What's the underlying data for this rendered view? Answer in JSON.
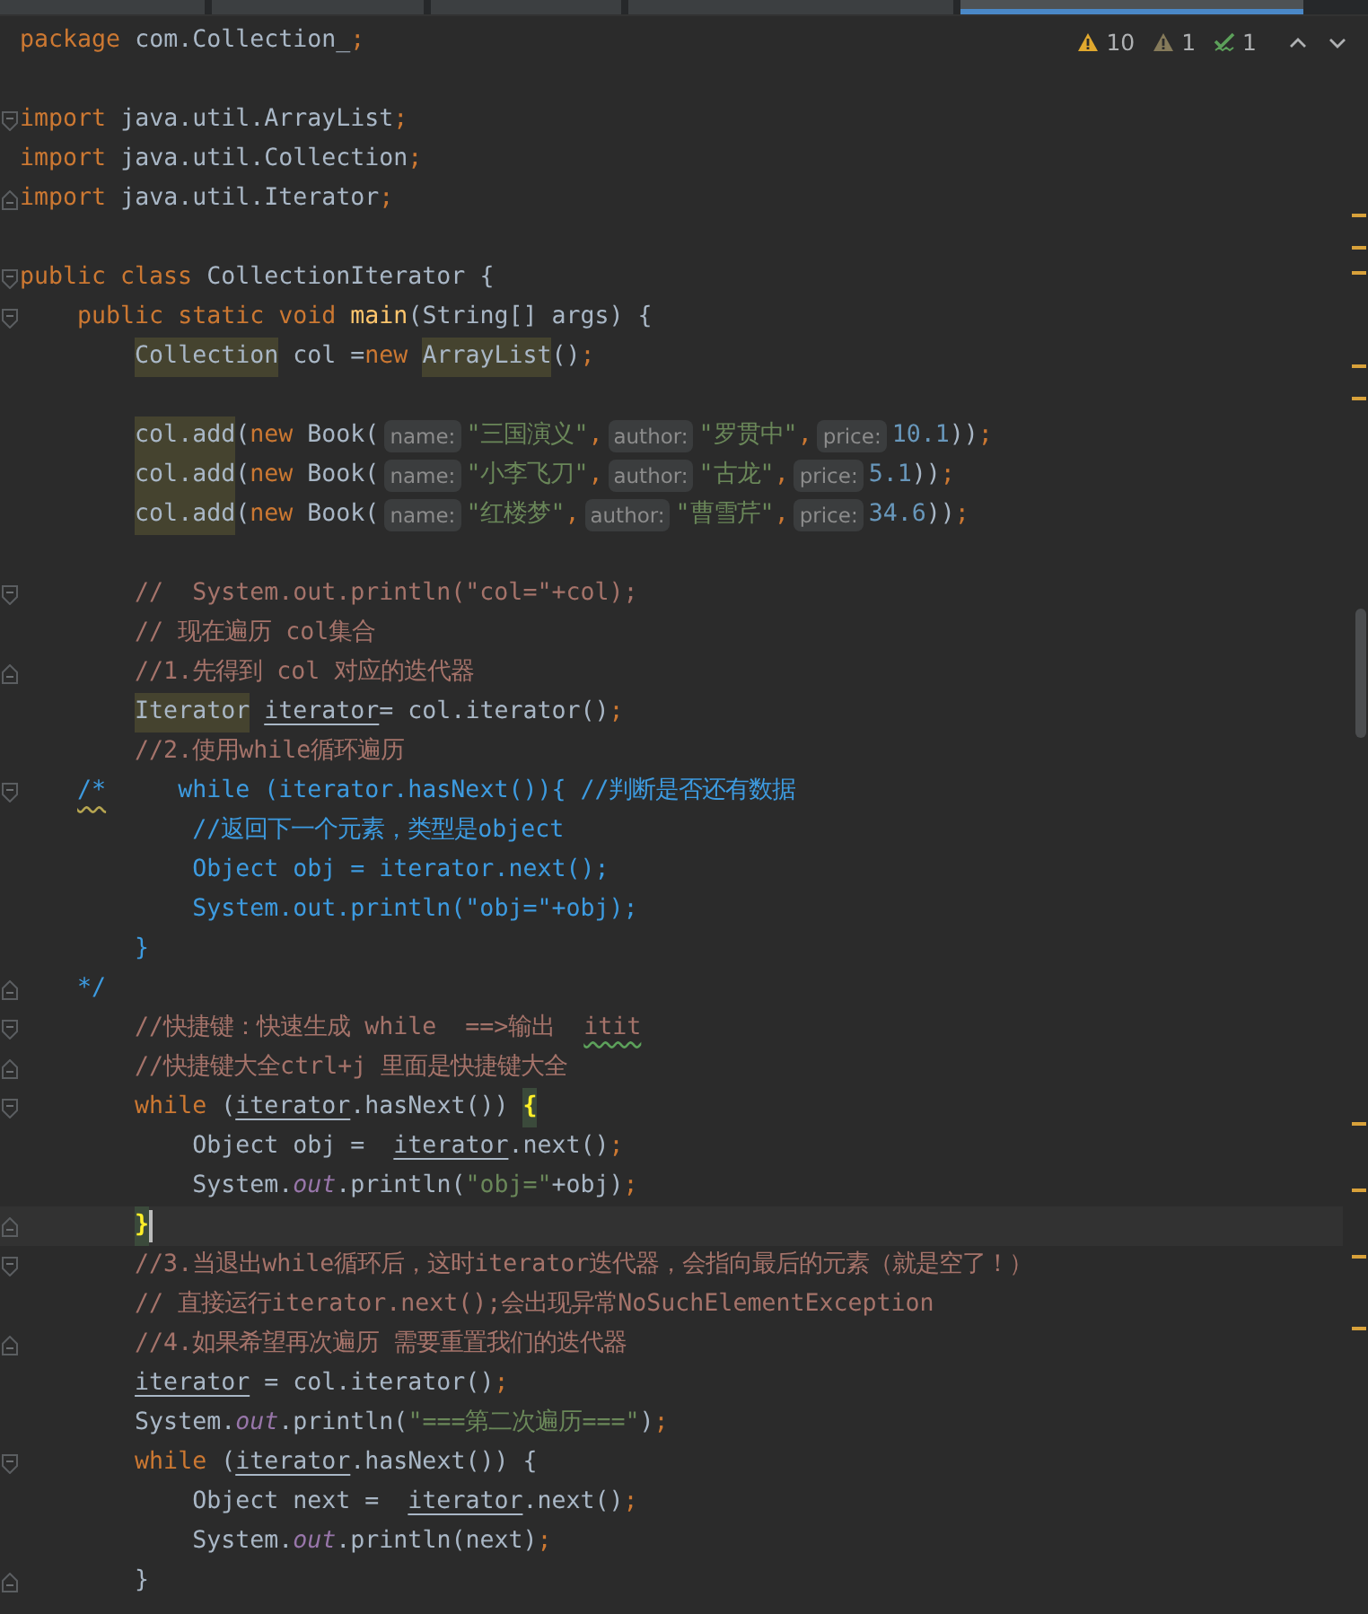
{
  "tabs": [
    {
      "selected": false
    },
    {
      "selected": false
    },
    {
      "selected": false
    },
    {
      "selected": false
    },
    {
      "selected": true
    }
  ],
  "inspections": [
    {
      "kind": "warning",
      "count": "10"
    },
    {
      "kind": "weak",
      "count": "1"
    },
    {
      "kind": "typo",
      "count": "1"
    }
  ],
  "lines": [
    {
      "current": false,
      "fold_open": false,
      "fold_close": false,
      "tokens": [
        {
          "kind": "keyword",
          "text": "package"
        },
        {
          "kind": "plain",
          "text": " com.Collection_"
        },
        {
          "kind": "punct",
          "text": ";"
        }
      ]
    },
    {
      "current": false,
      "fold_open": false,
      "fold_close": false
    },
    {
      "current": false,
      "fold_open": true,
      "fold_close": false,
      "tokens": [
        {
          "kind": "keyword",
          "text": "import"
        },
        {
          "kind": "plain",
          "text": " java.util.ArrayList"
        },
        {
          "kind": "punct",
          "text": ";"
        }
      ]
    },
    {
      "current": false,
      "fold_open": false,
      "fold_close": false,
      "tokens": [
        {
          "kind": "keyword",
          "text": "import"
        },
        {
          "kind": "plain",
          "text": " java.util.Collection"
        },
        {
          "kind": "punct",
          "text": ";"
        }
      ]
    },
    {
      "current": false,
      "fold_open": false,
      "fold_close": true,
      "tokens": [
        {
          "kind": "keyword",
          "text": "import"
        },
        {
          "kind": "plain",
          "text": " java.util.Iterator"
        },
        {
          "kind": "punct",
          "text": ";"
        }
      ]
    },
    {
      "current": false,
      "fold_open": false,
      "fold_close": false
    },
    {
      "current": false,
      "fold_open": true,
      "fold_close": false,
      "tokens": [
        {
          "kind": "keyword",
          "text": "public class"
        },
        {
          "kind": "plain",
          "text": " CollectionIterator {"
        }
      ]
    },
    {
      "current": false,
      "fold_open": true,
      "fold_close": false,
      "tokens": [
        {
          "kind": "keyword",
          "text": "    public static void"
        },
        {
          "kind": "method",
          "text": " main"
        },
        {
          "kind": "plain",
          "text": "(String[] args) {"
        }
      ]
    },
    {
      "current": false,
      "fold_open": false,
      "fold_close": false,
      "tokens": [
        {
          "kind": "highlight",
          "text": "        Collection"
        },
        {
          "kind": "plain",
          "text": " col ="
        },
        {
          "kind": "keyword",
          "text": "new"
        },
        {
          "kind": "highlight",
          "text": " ArrayList"
        },
        {
          "kind": "plain",
          "text": "()"
        },
        {
          "kind": "punct",
          "text": ";"
        }
      ]
    },
    {
      "current": false,
      "fold_open": false,
      "fold_close": false
    },
    {
      "current": false,
      "fold_open": false,
      "fold_close": false,
      "tokens": [
        {
          "kind": "highlight",
          "text": "        col.add"
        },
        {
          "kind": "plain",
          "text": "("
        },
        {
          "kind": "keyword",
          "text": "new"
        },
        {
          "kind": "plain",
          "text": " Book("
        },
        {
          "kind": "hint",
          "text": "name:"
        },
        {
          "kind": "string",
          "text": "\"三国演义\""
        },
        {
          "kind": "punct",
          "text": ","
        },
        {
          "kind": "hint",
          "text": "author:"
        },
        {
          "kind": "string",
          "text": "\"罗贯中\""
        },
        {
          "kind": "punct",
          "text": ","
        },
        {
          "kind": "hint",
          "text": "price:"
        },
        {
          "kind": "number",
          "text": "10.1"
        },
        {
          "kind": "plain",
          "text": "))"
        },
        {
          "kind": "punct",
          "text": ";"
        }
      ]
    },
    {
      "current": false,
      "fold_open": false,
      "fold_close": false,
      "tokens": [
        {
          "kind": "highlight",
          "text": "        col.add"
        },
        {
          "kind": "plain",
          "text": "("
        },
        {
          "kind": "keyword",
          "text": "new"
        },
        {
          "kind": "plain",
          "text": " Book("
        },
        {
          "kind": "hint",
          "text": "name:"
        },
        {
          "kind": "string",
          "text": "\"小李飞刀\""
        },
        {
          "kind": "punct",
          "text": ","
        },
        {
          "kind": "hint",
          "text": "author:"
        },
        {
          "kind": "string",
          "text": "\"古龙\""
        },
        {
          "kind": "punct",
          "text": ","
        },
        {
          "kind": "hint",
          "text": "price:"
        },
        {
          "kind": "number",
          "text": "5.1"
        },
        {
          "kind": "plain",
          "text": "))"
        },
        {
          "kind": "punct",
          "text": ";"
        }
      ]
    },
    {
      "current": false,
      "fold_open": false,
      "fold_close": false,
      "tokens": [
        {
          "kind": "highlight",
          "text": "        col.add"
        },
        {
          "kind": "plain",
          "text": "("
        },
        {
          "kind": "keyword",
          "text": "new"
        },
        {
          "kind": "plain",
          "text": " Book("
        },
        {
          "kind": "hint",
          "text": "name:"
        },
        {
          "kind": "string",
          "text": "\"红楼梦\""
        },
        {
          "kind": "punct",
          "text": ","
        },
        {
          "kind": "hint",
          "text": "author:"
        },
        {
          "kind": "string",
          "text": "\"曹雪芹\""
        },
        {
          "kind": "punct",
          "text": ","
        },
        {
          "kind": "hint",
          "text": "price:"
        },
        {
          "kind": "number",
          "text": "34.6"
        },
        {
          "kind": "plain",
          "text": "))"
        },
        {
          "kind": "punct",
          "text": ";"
        }
      ]
    },
    {
      "current": false,
      "fold_open": false,
      "fold_close": false
    },
    {
      "current": false,
      "fold_open": true,
      "fold_close": false,
      "tokens": [
        {
          "kind": "comment",
          "text": "        //  System.out.println(\"col=\"+col);"
        }
      ]
    },
    {
      "current": false,
      "fold_open": false,
      "fold_close": false,
      "tokens": [
        {
          "kind": "comment",
          "text": "        // 现在遍历 col集合"
        }
      ]
    },
    {
      "current": false,
      "fold_open": false,
      "fold_close": true,
      "tokens": [
        {
          "kind": "comment",
          "text": "        //1.先得到 col 对应的迭代器"
        }
      ]
    },
    {
      "current": false,
      "fold_open": false,
      "fold_close": false,
      "tokens": [
        {
          "kind": "highlight",
          "text": "        Iterator"
        },
        {
          "kind": "underline",
          "text": " iterator"
        },
        {
          "kind": "plain",
          "text": "= col.iterator()"
        },
        {
          "kind": "punct",
          "text": ";"
        }
      ]
    },
    {
      "current": false,
      "fold_open": false,
      "fold_close": false,
      "tokens": [
        {
          "kind": "comment",
          "text": "        //2.使用while循环遍历"
        }
      ]
    },
    {
      "current": false,
      "fold_open": true,
      "fold_close": false,
      "tokens": [
        {
          "kind": "doc-typo",
          "text": "    /*"
        },
        {
          "kind": "doc",
          "text": "     while (iterator.hasNext()){ //判断是否还有数据"
        }
      ]
    },
    {
      "current": false,
      "fold_open": false,
      "fold_close": false,
      "tokens": [
        {
          "kind": "doc",
          "text": "            //返回下一个元素，类型是object"
        }
      ]
    },
    {
      "current": false,
      "fold_open": false,
      "fold_close": false,
      "tokens": [
        {
          "kind": "doc",
          "text": "            Object obj = iterator.next();"
        }
      ]
    },
    {
      "current": false,
      "fold_open": false,
      "fold_close": false,
      "tokens": [
        {
          "kind": "doc",
          "text": "            System.out.println(\"obj=\"+obj);"
        }
      ]
    },
    {
      "current": false,
      "fold_open": false,
      "fold_close": false,
      "tokens": [
        {
          "kind": "doc",
          "text": "        }"
        }
      ]
    },
    {
      "current": false,
      "fold_open": false,
      "fold_close": true,
      "tokens": [
        {
          "kind": "doc",
          "text": "    */"
        }
      ]
    },
    {
      "current": false,
      "fold_open": true,
      "fold_close": false,
      "tokens": [
        {
          "kind": "comment",
          "text": "        //快捷键：快速生成 while  ==>输出"
        },
        {
          "kind": "typo",
          "text": "  itit"
        }
      ]
    },
    {
      "current": false,
      "fold_open": false,
      "fold_close": true,
      "tokens": [
        {
          "kind": "comment",
          "text": "        //快捷键大全ctrl+j 里面是快捷键大全"
        }
      ]
    },
    {
      "current": false,
      "fold_open": true,
      "fold_close": false,
      "tokens": [
        {
          "kind": "keyword",
          "text": "        while"
        },
        {
          "kind": "plain",
          "text": " ("
        },
        {
          "kind": "underline",
          "text": "iterator"
        },
        {
          "kind": "plain",
          "text": ".hasNext())"
        },
        {
          "kind": "match",
          "text": " {"
        }
      ]
    },
    {
      "current": false,
      "fold_open": false,
      "fold_close": false,
      "tokens": [
        {
          "kind": "plain",
          "text": "            Object obj ="
        },
        {
          "kind": "underline",
          "text": "  iterator"
        },
        {
          "kind": "plain",
          "text": ".next()"
        },
        {
          "kind": "punct",
          "text": ";"
        }
      ]
    },
    {
      "current": false,
      "fold_open": false,
      "fold_close": false,
      "tokens": [
        {
          "kind": "plain",
          "text": "            System."
        },
        {
          "kind": "field",
          "text": "out"
        },
        {
          "kind": "plain",
          "text": ".println("
        },
        {
          "kind": "string",
          "text": "\"obj=\""
        },
        {
          "kind": "plain",
          "text": "+obj)"
        },
        {
          "kind": "punct",
          "text": ";"
        }
      ]
    },
    {
      "current": true,
      "fold_open": false,
      "fold_close": true,
      "tokens": [
        {
          "kind": "match",
          "text": "        }"
        }
      ]
    },
    {
      "current": false,
      "fold_open": true,
      "fold_close": false,
      "tokens": [
        {
          "kind": "comment",
          "text": "        //3.当退出while循环后，这时iterator迭代器，会指向最后的元素（就是空了！）"
        }
      ]
    },
    {
      "current": false,
      "fold_open": false,
      "fold_close": false,
      "tokens": [
        {
          "kind": "comment",
          "text": "        // 直接运行iterator.next();会出现异常NoSuchElementException"
        }
      ]
    },
    {
      "current": false,
      "fold_open": false,
      "fold_close": true,
      "tokens": [
        {
          "kind": "comment",
          "text": "        //4.如果希望再次遍历 需要重置我们的迭代器"
        }
      ]
    },
    {
      "current": false,
      "fold_open": false,
      "fold_close": false,
      "tokens": [
        {
          "kind": "underline",
          "text": "        iterator"
        },
        {
          "kind": "plain",
          "text": " = col.iterator()"
        },
        {
          "kind": "punct",
          "text": ";"
        }
      ]
    },
    {
      "current": false,
      "fold_open": false,
      "fold_close": false,
      "tokens": [
        {
          "kind": "plain",
          "text": "        System."
        },
        {
          "kind": "field",
          "text": "out"
        },
        {
          "kind": "plain",
          "text": ".println("
        },
        {
          "kind": "string",
          "text": "\"===第二次遍历===\""
        },
        {
          "kind": "plain",
          "text": ")"
        },
        {
          "kind": "punct",
          "text": ";"
        }
      ]
    },
    {
      "current": false,
      "fold_open": true,
      "fold_close": false,
      "tokens": [
        {
          "kind": "keyword",
          "text": "        while"
        },
        {
          "kind": "plain",
          "text": " ("
        },
        {
          "kind": "underline",
          "text": "iterator"
        },
        {
          "kind": "plain",
          "text": ".hasNext()) {"
        }
      ]
    },
    {
      "current": false,
      "fold_open": false,
      "fold_close": false,
      "tokens": [
        {
          "kind": "plain",
          "text": "            Object next ="
        },
        {
          "kind": "underline",
          "text": "  iterator"
        },
        {
          "kind": "plain",
          "text": ".next()"
        },
        {
          "kind": "punct",
          "text": ";"
        }
      ]
    },
    {
      "current": false,
      "fold_open": false,
      "fold_close": false,
      "tokens": [
        {
          "kind": "plain",
          "text": "            System."
        },
        {
          "kind": "field",
          "text": "out"
        },
        {
          "kind": "plain",
          "text": ".println(next)"
        },
        {
          "kind": "punct",
          "text": ";"
        }
      ]
    },
    {
      "current": false,
      "fold_open": false,
      "fold_close": true,
      "tokens": [
        {
          "kind": "plain",
          "text": "        }"
        }
      ]
    }
  ]
}
